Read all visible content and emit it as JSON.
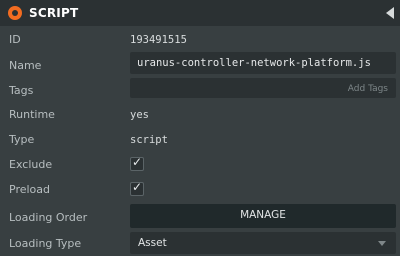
{
  "header": {
    "title": "SCRIPT",
    "icon": "script-asset-icon",
    "collapse_icon": "collapse-arrow-icon"
  },
  "fields": {
    "id": {
      "label": "ID",
      "value": "193491515"
    },
    "name": {
      "label": "Name",
      "value": "uranus-controller-network-platform.js"
    },
    "tags": {
      "label": "Tags",
      "placeholder": "",
      "add_label": "Add Tags"
    },
    "runtime": {
      "label": "Runtime",
      "value": "yes"
    },
    "type": {
      "label": "Type",
      "value": "script"
    },
    "exclude": {
      "label": "Exclude",
      "checked": true
    },
    "preload": {
      "label": "Preload",
      "checked": true
    },
    "loading_order": {
      "label": "Loading Order",
      "button_label": "MANAGE"
    },
    "loading_type": {
      "label": "Loading Type",
      "selected": "Asset"
    }
  },
  "colors": {
    "accent": "#f26c21",
    "panel_bg": "#383f41",
    "field_bg": "#2b3133"
  }
}
